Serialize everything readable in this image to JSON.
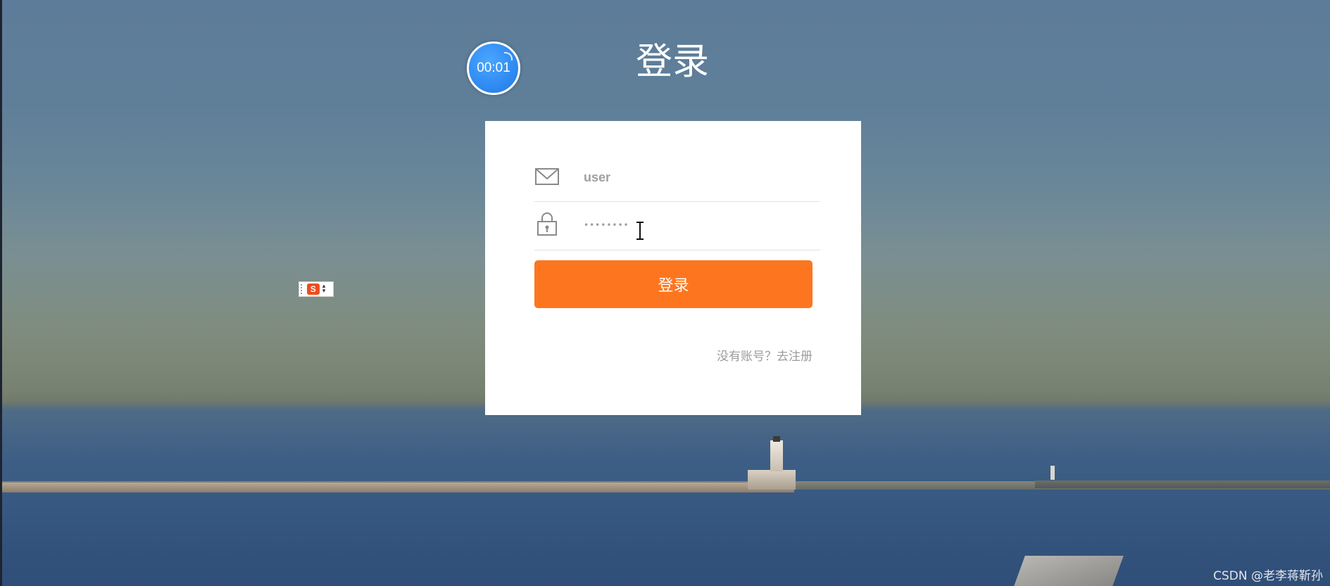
{
  "timer": {
    "display": "00:01"
  },
  "header": {
    "title": "登录"
  },
  "ime": {
    "logo_letter": "S"
  },
  "login_form": {
    "username": {
      "value": "user",
      "icon": "mail-icon"
    },
    "password": {
      "masked_value": "••••••••",
      "icon": "lock-icon"
    },
    "submit_label": "登录",
    "register_prompt": "没有账号？去注册"
  },
  "watermark": "CSDN @老李蒋靳孙",
  "colors": {
    "button": "#fd761f",
    "card": "#ffffff",
    "timer": "#1f78e8",
    "muted_text": "#9c9c9c"
  }
}
